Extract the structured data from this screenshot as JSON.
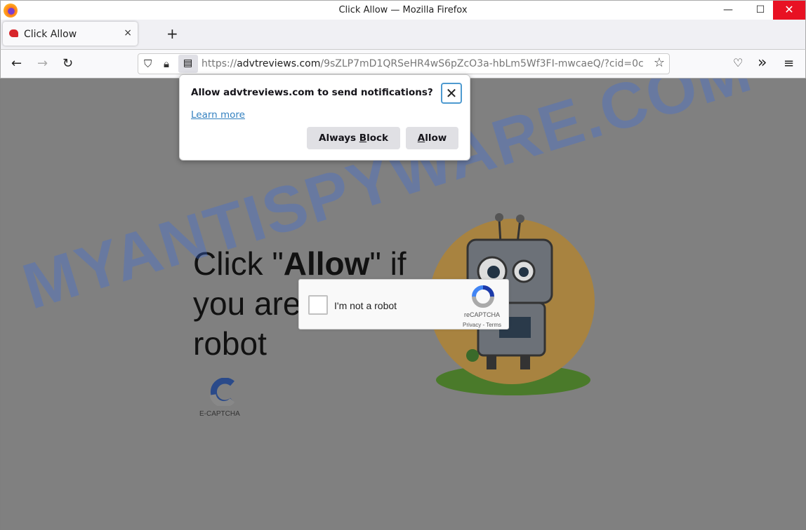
{
  "window": {
    "title": "Click Allow — Mozilla Firefox",
    "minimize": "—",
    "maximize": "☐",
    "close": "✕"
  },
  "tab": {
    "label": "Click Allow",
    "close": "×",
    "new_tab": "+"
  },
  "nav": {
    "back": "←",
    "forward": "→",
    "reload": "↻",
    "url_scheme": "https://",
    "url_host": "advtreviews.com",
    "url_path": "/9sZLP7mD1QRSeHR4wS6pZcO3a-hbLm5Wf3FI-mwcaeQ/?cid=0c",
    "bookmark": "☆",
    "pocket": "♡",
    "more_tools": "»",
    "menu": "≡"
  },
  "popup": {
    "question": "Allow advtreviews.com to send notifications?",
    "learn_more": "Learn more",
    "block_pre": "Always ",
    "block_key": "B",
    "block_post": "lock",
    "allow_key": "A",
    "allow_post": "llow",
    "close": "✕"
  },
  "page": {
    "headline_pre": "Click \"",
    "headline_bold": "Allow",
    "headline_post": "\" if",
    "line2": "you are not a",
    "line3": "robot",
    "ecaptcha": "E-CAPTCHA",
    "recaptcha": {
      "label": "I'm not a robot",
      "brand": "reCAPTCHA",
      "links": "Privacy - Terms"
    }
  },
  "watermark": "MYANTISPYWARE.COM",
  "colors": {
    "accent": "#0061b0",
    "close_red": "#e81123",
    "overlay": "#808080"
  }
}
